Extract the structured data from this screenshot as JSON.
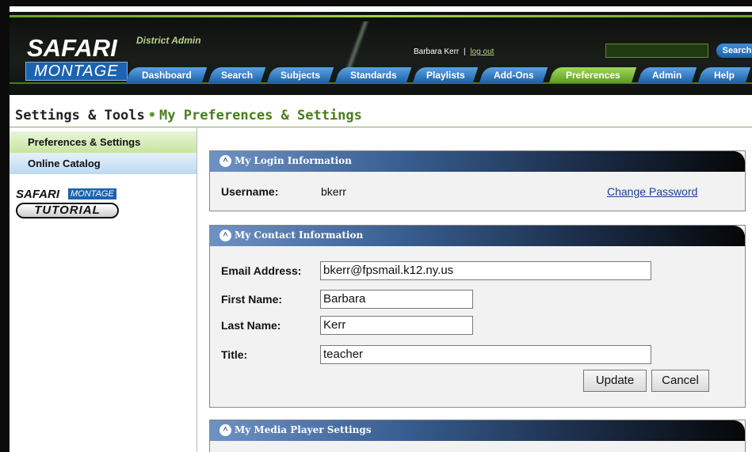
{
  "header": {
    "logo_top": "SAFARI",
    "logo_bottom": "MONTAGE",
    "role": "District Admin",
    "user_name": "Barbara Kerr",
    "separator": "|",
    "logout": "log out",
    "search_button": "Search",
    "search_value": "",
    "nav": [
      {
        "label": "Dashboard"
      },
      {
        "label": "Search"
      },
      {
        "label": "Subjects"
      },
      {
        "label": "Standards"
      },
      {
        "label": "Playlists"
      },
      {
        "label": "Add-Ons"
      },
      {
        "label": "Preferences",
        "active": true
      },
      {
        "label": "Admin"
      },
      {
        "label": "Help"
      }
    ]
  },
  "breadcrumb": {
    "root": "Settings & Tools",
    "bullet": "•",
    "current": "My Preferences & Settings"
  },
  "sidebar": {
    "items": [
      {
        "label": "Preferences & Settings",
        "active": true
      },
      {
        "label": "Online Catalog"
      }
    ],
    "tutorial": {
      "safari": "SAFARI",
      "montage": "MONTAGE",
      "button": "TUTORIAL"
    }
  },
  "login_panel": {
    "title": "My Login Information",
    "username_label": "Username:",
    "username_value": "bkerr",
    "change_password": "Change Password"
  },
  "contact_panel": {
    "title": "My Contact Information",
    "email_label": "Email Address:",
    "email_value": "bkerr@fpsmail.k12.ny.us",
    "first_label": "First Name:",
    "first_value": "Barbara",
    "last_label": "Last Name:",
    "last_value": "Kerr",
    "title_label": "Title:",
    "title_value": "teacher",
    "update_button": "Update",
    "cancel_button": "Cancel"
  },
  "media_panel": {
    "title": "My Media Player Settings"
  },
  "colors": {
    "accent_green": "#5f9a2a",
    "nav_blue": "#1c5fa6",
    "link_blue": "#1a3f96"
  }
}
